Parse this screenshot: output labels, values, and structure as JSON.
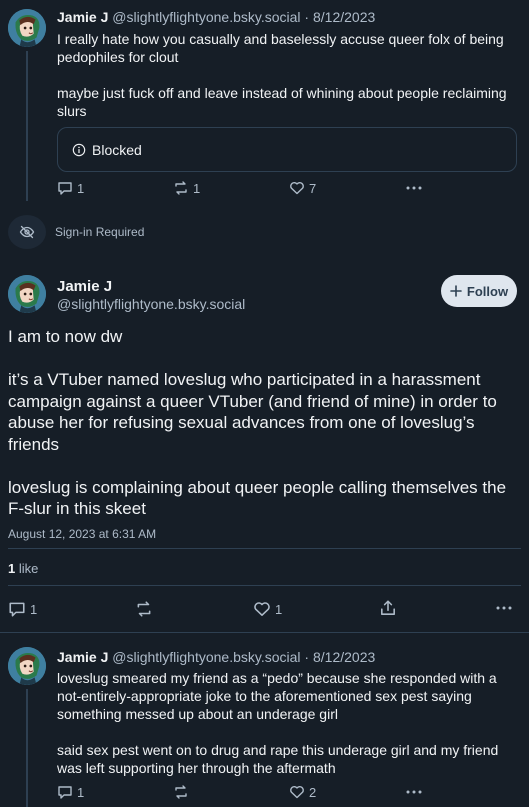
{
  "post1": {
    "author": "Jamie J",
    "handle": "@slightlyflightyone.bsky.social",
    "separator": "·",
    "date": "8/12/2023",
    "paragraphs": [
      "I really hate how you casually and baselessly accuse queer folx of being pedophiles for clout",
      "maybe just fuck off and leave instead of whining about people reclaiming slurs"
    ],
    "blocked_label": "Blocked",
    "replies": "1",
    "reposts": "1",
    "likes": "7"
  },
  "signin": {
    "label": "Sign-in Required"
  },
  "main_post": {
    "author": "Jamie J",
    "handle": "@slightlyflightyone.bsky.social",
    "follow_label": "Follow",
    "paragraphs": [
      "I am to now dw",
      "it’s a VTuber named loveslug who participated in a harassment campaign against a queer VTuber (and friend of mine) in order to abuse her for refusing sexual advances from one of loveslug’s friends",
      "loveslug is complaining about queer people calling themselves the F-slur in this skeet"
    ],
    "timestamp": "August 12, 2023 at 6:31 AM",
    "like_count": "1",
    "like_word": "like",
    "replies": "1",
    "likes": "1"
  },
  "post3": {
    "author": "Jamie J",
    "handle": "@slightlyflightyone.bsky.social",
    "separator": "·",
    "date": "8/12/2023",
    "paragraphs": [
      "loveslug smeared my friend as a “pedo” because she responded with a not-entirely-appropriate joke to the aforementioned sex pest saying something messed up about an underage girl",
      "said sex pest went on to drug and rape this underage girl and my friend was left supporting her through the aftermath"
    ],
    "replies": "1",
    "likes": "2"
  },
  "colors": {
    "background": "#161e27",
    "muted_text": "#aebbc9",
    "border": "#2e4052",
    "follow_bg": "#dfe6ee"
  }
}
